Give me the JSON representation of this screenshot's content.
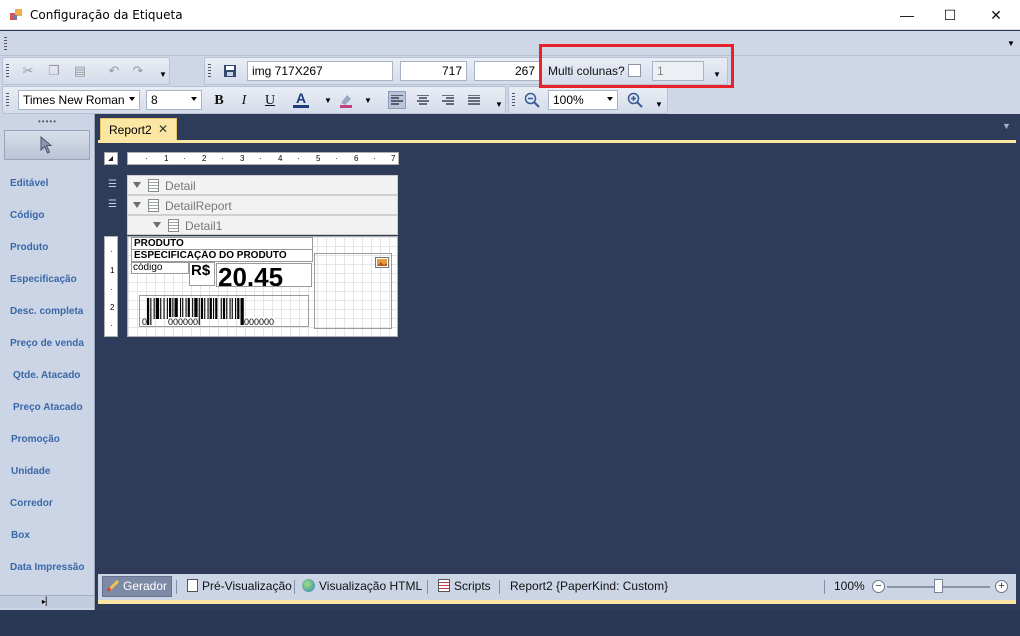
{
  "window": {
    "title": "Configuração da Etiqueta",
    "minimize": "—",
    "maximize": "☐",
    "close": "✕"
  },
  "toolbar": {
    "image_name": "img 717X267",
    "width_value": "717",
    "height_value": "267",
    "multi_columns_label": "Multi colunas?",
    "multi_columns_checked": false,
    "columns_value": "1",
    "font_name": "Times New Roman",
    "font_size": "8",
    "bold": "B",
    "italic": "I",
    "underline": "U",
    "font_color_glyph": "A",
    "zoom": "100%"
  },
  "toolbox": {
    "items": [
      "Editável",
      "Código",
      "Produto",
      "Especificação",
      "Desc. completa",
      "Preço de venda",
      "Qtde.  Atacado",
      "Preço  Atacado",
      "Promoção",
      "Unidade",
      "Corredor",
      "Box",
      "Data Impressão"
    ]
  },
  "tabs": {
    "active": "Report2",
    "close": "✕"
  },
  "ruler": {
    "h_ticks": [
      "1",
      "2",
      "3",
      "4",
      "5",
      "6",
      "7"
    ],
    "v_ticks": [
      "1",
      "2"
    ]
  },
  "bands": {
    "detail": "Detail",
    "detail_report": "DetailReport",
    "detail1": "Detail1"
  },
  "label": {
    "produto": "PRODUTO",
    "especificacao": "ESPECIFICAÇÃO DO PRODUTO",
    "codigo": "código",
    "currency": "R$",
    "price": "20.45",
    "barcode_left_digit": "0",
    "barcode_group1": "000000",
    "barcode_group2": "000000"
  },
  "statusbar": {
    "tabs": [
      "Gerador",
      "Pré-Visualização",
      "Visualização HTML",
      "Scripts"
    ],
    "active_tab": "Gerador",
    "report_info": "Report2 {PaperKind: Custom}",
    "zoom": "100%",
    "zoom_level": 1.0
  },
  "colors": {
    "highlight": "#e8222a",
    "tab_accent": "#fbe6a3",
    "toolbox_text": "#3967a8",
    "workspace": "#2e3c5a"
  }
}
